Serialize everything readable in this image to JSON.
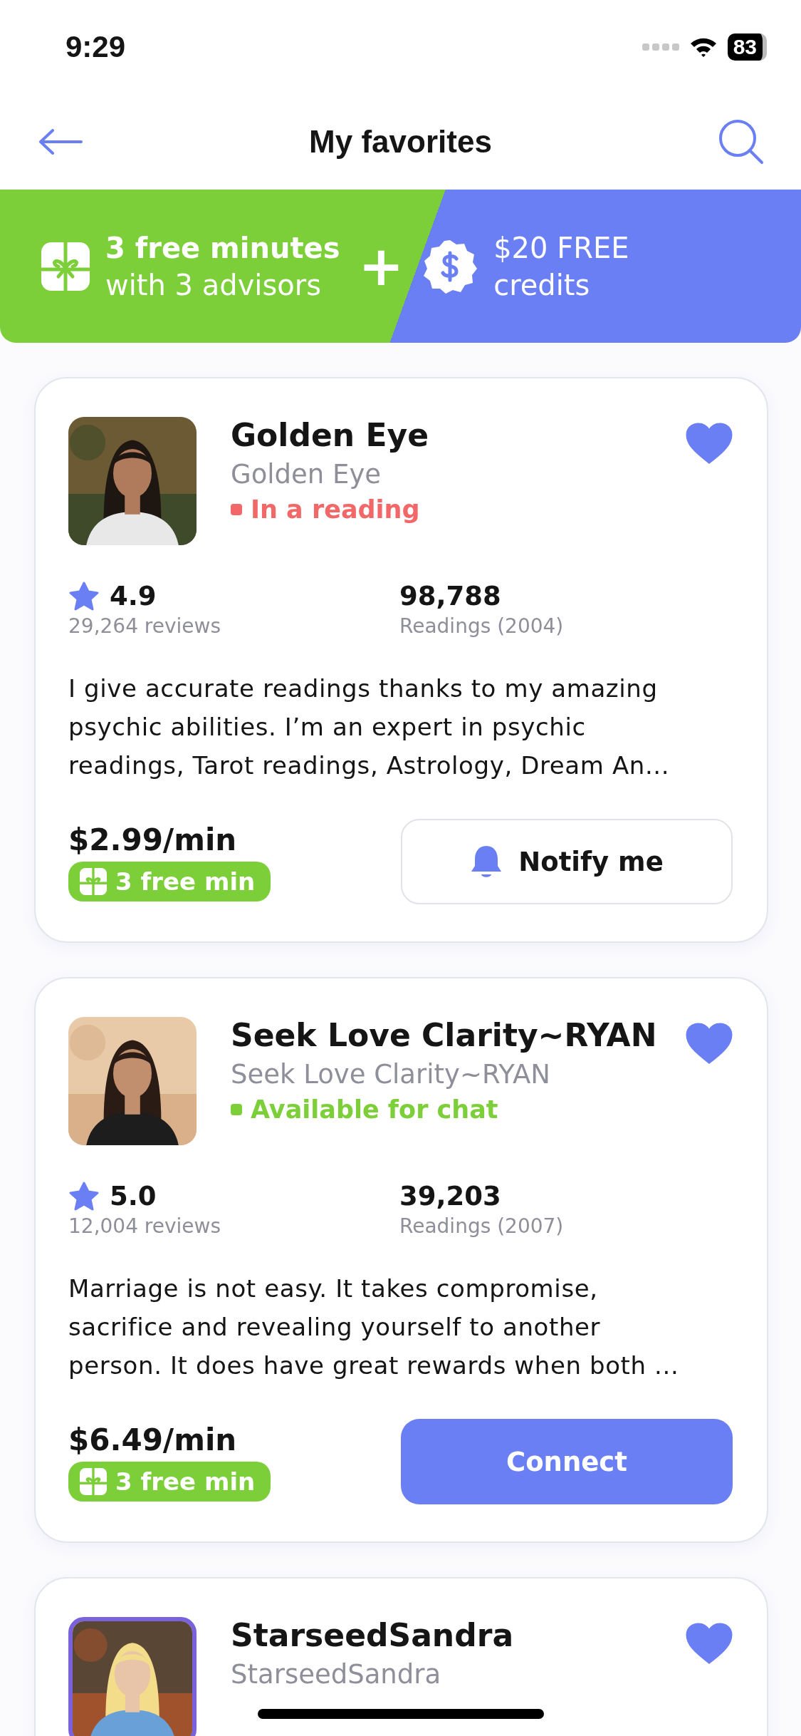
{
  "status_bar": {
    "time": "9:29",
    "battery": "83"
  },
  "header": {
    "title": "My favorites"
  },
  "promo": {
    "left_line_1": "3 free minutes",
    "left_line_2": "with 3 advisors",
    "plus": "+",
    "right_line_1": "$20 FREE",
    "right_line_2": "credits"
  },
  "advisors": [
    {
      "name": "Golden Eye",
      "subtitle": "Golden Eye",
      "status": {
        "text": "In a reading",
        "color": "#f26767"
      },
      "favorited": true,
      "ringed": false,
      "rating": "4.9",
      "reviews": "29,264 reviews",
      "readings": "98,788",
      "readings_label": "Readings (2004)",
      "description": "I give accurate readings thanks to my amazing psychic abilities. I’m an expert in psychic readings, Tarot readings, Astrology, Dream An...",
      "price": "$2.99/min",
      "free_badge": "3 free min",
      "action": {
        "kind": "notify",
        "label": "Notify me"
      }
    },
    {
      "name": "Seek Love Clarity~RYAN",
      "subtitle": "Seek Love Clarity~RYAN",
      "status": {
        "text": "Available for chat",
        "color": "#7ccf38"
      },
      "favorited": true,
      "ringed": false,
      "rating": "5.0",
      "reviews": "12,004 reviews",
      "readings": "39,203",
      "readings_label": "Readings (2007)",
      "description": "Marriage is not easy. It takes compromise, sacrifice and revealing yourself to another person. It does have great rewards when both ...",
      "price": "$6.49/min",
      "free_badge": "3 free min",
      "action": {
        "kind": "connect",
        "label": "Connect"
      }
    },
    {
      "name": "StarseedSandra",
      "subtitle": "StarseedSandra",
      "favorited": true,
      "ringed": true
    }
  ]
}
